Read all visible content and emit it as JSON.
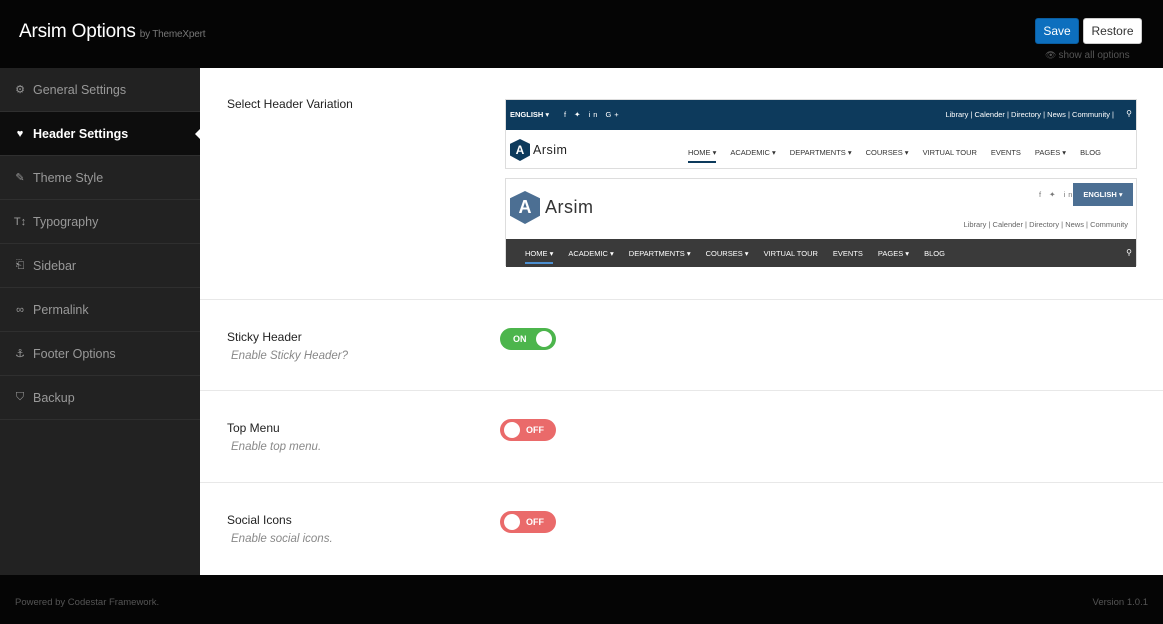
{
  "header": {
    "title": "Arsim Options",
    "by": "by ThemeXpert",
    "save_label": "Save",
    "restore_label": "Restore",
    "show_all": "show all options"
  },
  "sidebar": {
    "items": [
      {
        "label": "General Settings",
        "icon": "gears-icon",
        "active": false
      },
      {
        "label": "Header Settings",
        "icon": "heart-icon",
        "active": true
      },
      {
        "label": "Theme Style",
        "icon": "brush-icon",
        "active": false
      },
      {
        "label": "Typography",
        "icon": "text-height-icon",
        "active": false
      },
      {
        "label": "Sidebar",
        "icon": "sidebar-icon",
        "active": false
      },
      {
        "label": "Permalink",
        "icon": "link-icon",
        "active": false
      },
      {
        "label": "Footer Options",
        "icon": "anchor-icon",
        "active": false
      },
      {
        "label": "Backup",
        "icon": "shield-icon",
        "active": false
      }
    ]
  },
  "main": {
    "header_variation": {
      "label": "Select Header Variation",
      "preview1": {
        "lang": "ENGLISH ▾",
        "social": "f ✦ in G+",
        "links": "Library | Calender | Directory | News | Community |",
        "logo_letter": "A",
        "logo_word": "Arsim",
        "menu": [
          "HOME ▾",
          "ACADEMIC ▾",
          "DEPARTMENTS ▾",
          "COURSES ▾",
          "VIRTUAL TOUR",
          "EVENTS",
          "PAGES ▾",
          "BLOG"
        ]
      },
      "preview2": {
        "logo_letter": "A",
        "logo_word": "Arsim",
        "social": "f ✦ in",
        "lang": "ENGLISH ▾",
        "links": "Library | Calender | Directory | News | Community",
        "menu": [
          "HOME ▾",
          "ACADEMIC ▾",
          "DEPARTMENTS ▾",
          "COURSES ▾",
          "VIRTUAL TOUR",
          "EVENTS",
          "PAGES ▾",
          "BLOG"
        ]
      }
    },
    "sticky_header": {
      "label": "Sticky Header",
      "desc": "Enable Sticky Header?",
      "state": "ON"
    },
    "top_menu": {
      "label": "Top Menu",
      "desc": "Enable top menu.",
      "state": "OFF"
    },
    "social_icons": {
      "label": "Social Icons",
      "desc": "Enable social icons.",
      "state": "OFF"
    }
  },
  "footer": {
    "left": "Powered by Codestar Framework.",
    "right": "Version 1.0.1"
  },
  "colors": {
    "accent_blue": "#0d6fbe",
    "toggle_on": "#4cb54c",
    "toggle_off": "#ea6a6a",
    "preview_navy": "#0d3a5c"
  }
}
